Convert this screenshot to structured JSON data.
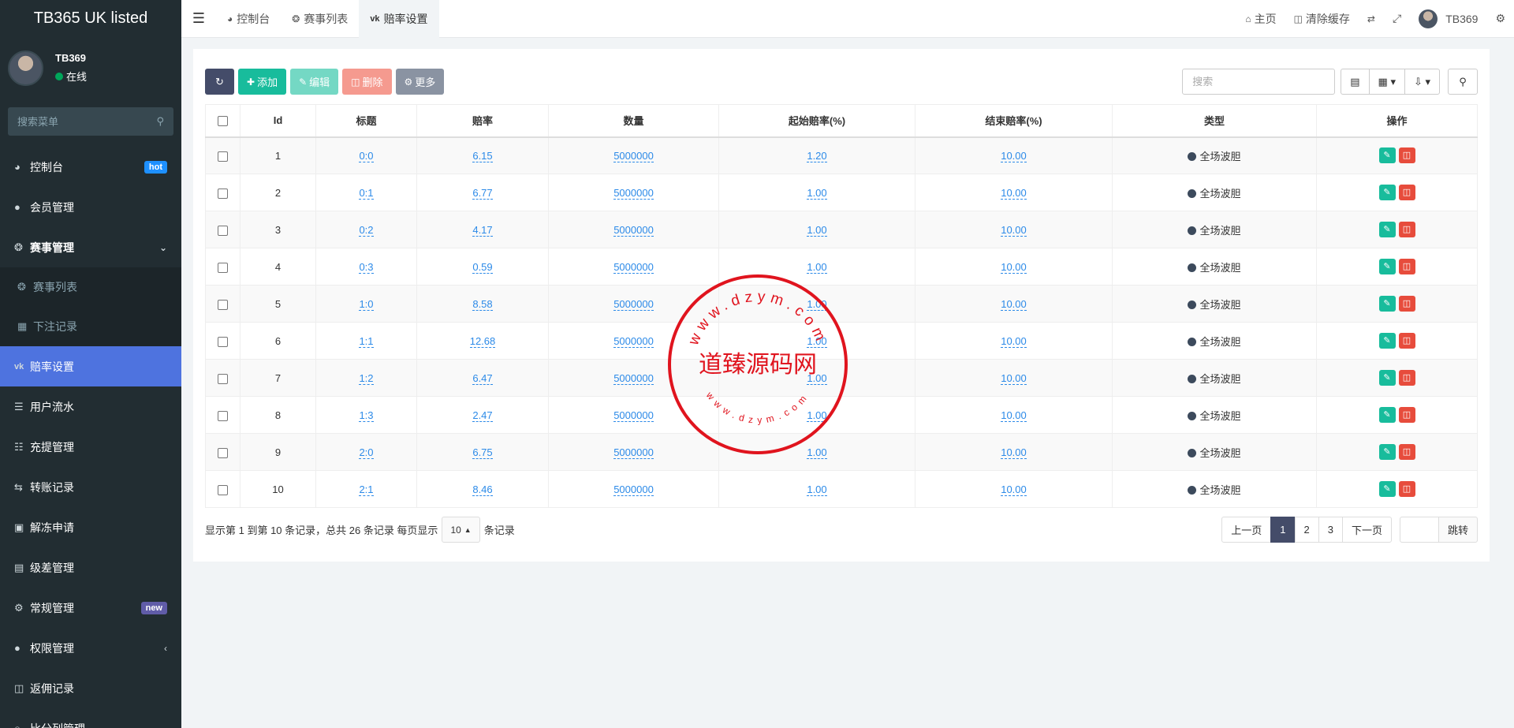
{
  "brand": "TB365 UK listed",
  "user": {
    "name": "TB369",
    "status": "在线"
  },
  "sidebar": {
    "search_placeholder": "搜索菜单",
    "items": [
      {
        "label": "控制台",
        "icon": "dashboard-icon",
        "badge": "hot"
      },
      {
        "label": "会员管理",
        "icon": "users-icon"
      },
      {
        "label": "赛事管理",
        "icon": "lifering-icon"
      },
      {
        "label": "赛事列表",
        "icon": "lifering-icon"
      },
      {
        "label": "下注记录",
        "icon": "calendar-icon"
      },
      {
        "label": "赔率设置",
        "icon": "vk-icon"
      },
      {
        "label": "用户流水",
        "icon": "list-icon"
      },
      {
        "label": "充提管理",
        "icon": "list-alt-icon"
      },
      {
        "label": "转账记录",
        "icon": "exchange-icon"
      },
      {
        "label": "解冻申请",
        "icon": "image-icon"
      },
      {
        "label": "级差管理",
        "icon": "window-icon"
      },
      {
        "label": "常规管理",
        "icon": "cogs-icon",
        "badge": "new"
      },
      {
        "label": "权限管理",
        "icon": "group-icon"
      },
      {
        "label": "返佣记录",
        "icon": "money-icon"
      },
      {
        "label": "比分列管理",
        "icon": "circle-icon"
      }
    ]
  },
  "topbar": {
    "tabs": [
      {
        "label": "控制台"
      },
      {
        "label": "赛事列表"
      },
      {
        "label": "赔率设置"
      }
    ],
    "right": {
      "home": "主页",
      "clear_cache": "清除缓存",
      "username": "TB369"
    }
  },
  "toolbar": {
    "add": "添加",
    "edit": "编辑",
    "delete": "删除",
    "more": "更多",
    "search_placeholder": "搜索"
  },
  "table": {
    "headers": [
      "Id",
      "标题",
      "赔率",
      "数量",
      "起始赔率(%)",
      "结束赔率(%)",
      "类型",
      "操作"
    ],
    "rows": [
      {
        "id": "1",
        "title": "0:0",
        "odds": "6.15",
        "qty": "5000000",
        "start": "1.20",
        "end": "10.00",
        "type": "全场波胆"
      },
      {
        "id": "2",
        "title": "0:1",
        "odds": "6.77",
        "qty": "5000000",
        "start": "1.00",
        "end": "10.00",
        "type": "全场波胆"
      },
      {
        "id": "3",
        "title": "0:2",
        "odds": "4.17",
        "qty": "5000000",
        "start": "1.00",
        "end": "10.00",
        "type": "全场波胆"
      },
      {
        "id": "4",
        "title": "0:3",
        "odds": "0.59",
        "qty": "5000000",
        "start": "1.00",
        "end": "10.00",
        "type": "全场波胆"
      },
      {
        "id": "5",
        "title": "1:0",
        "odds": "8.58",
        "qty": "5000000",
        "start": "1.00",
        "end": "10.00",
        "type": "全场波胆"
      },
      {
        "id": "6",
        "title": "1:1",
        "odds": "12.68",
        "qty": "5000000",
        "start": "1.00",
        "end": "10.00",
        "type": "全场波胆"
      },
      {
        "id": "7",
        "title": "1:2",
        "odds": "6.47",
        "qty": "5000000",
        "start": "1.00",
        "end": "10.00",
        "type": "全场波胆"
      },
      {
        "id": "8",
        "title": "1:3",
        "odds": "2.47",
        "qty": "5000000",
        "start": "1.00",
        "end": "10.00",
        "type": "全场波胆"
      },
      {
        "id": "9",
        "title": "2:0",
        "odds": "6.75",
        "qty": "5000000",
        "start": "1.00",
        "end": "10.00",
        "type": "全场波胆"
      },
      {
        "id": "10",
        "title": "2:1",
        "odds": "8.46",
        "qty": "5000000",
        "start": "1.00",
        "end": "10.00",
        "type": "全场波胆"
      }
    ]
  },
  "footer": {
    "info_prefix": "显示第 1 到第 10 条记录，总共 26 条记录 每页显示",
    "page_size": "10",
    "info_suffix": "条记录",
    "prev": "上一页",
    "pages": [
      "1",
      "2",
      "3"
    ],
    "next": "下一页",
    "jump": "跳转"
  },
  "watermark": {
    "center": "道臻源码网",
    "ring": "www.dzym.com"
  },
  "colors": {
    "sidebar_bg": "#222d32",
    "active_menu": "#4e73df",
    "primary": "#444c69",
    "success": "#18bc9c",
    "danger": "#e74c3c",
    "link": "#2c8ae8",
    "seal": "#e0141e"
  }
}
